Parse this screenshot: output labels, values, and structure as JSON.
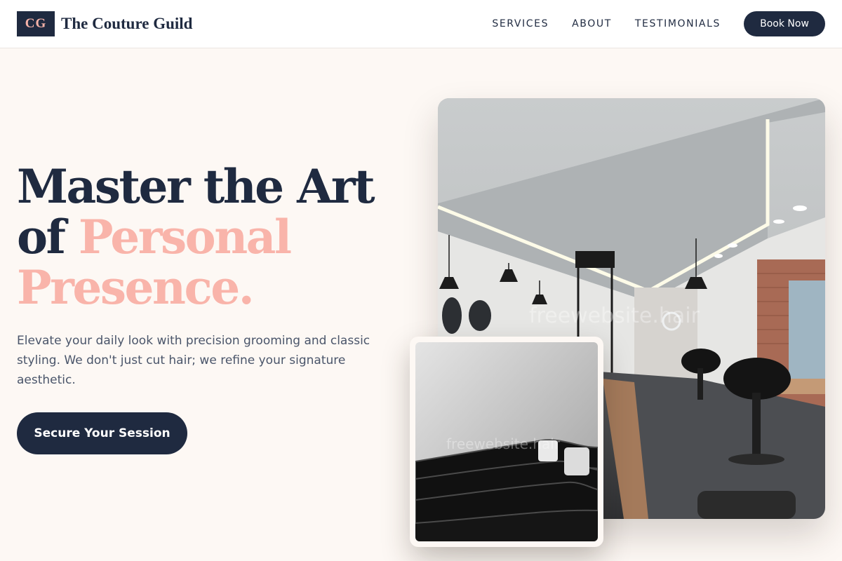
{
  "brand": {
    "mark": "CG",
    "name": "The Couture Guild"
  },
  "nav": {
    "links": [
      {
        "label": "SERVICES"
      },
      {
        "label": "ABOUT"
      },
      {
        "label": "TESTIMONIALS"
      }
    ],
    "cta": "Book Now"
  },
  "hero": {
    "title_line1": "Master the Art",
    "title_line2_plain": "of ",
    "title_line2_accent": "Personal",
    "title_line3_accent": "Presence.",
    "subtitle": "Elevate your daily look with precision grooming and classic styling. We don't just cut hair; we refine your signature aesthetic.",
    "cta": "Secure Your Session"
  },
  "images": {
    "main_watermark": "freewebsite.hair",
    "inset_watermark": "freewebsite.hair"
  },
  "colors": {
    "navy": "#1f2a40",
    "accent_pink": "#f9b4aa",
    "background": "#fdf8f4"
  }
}
